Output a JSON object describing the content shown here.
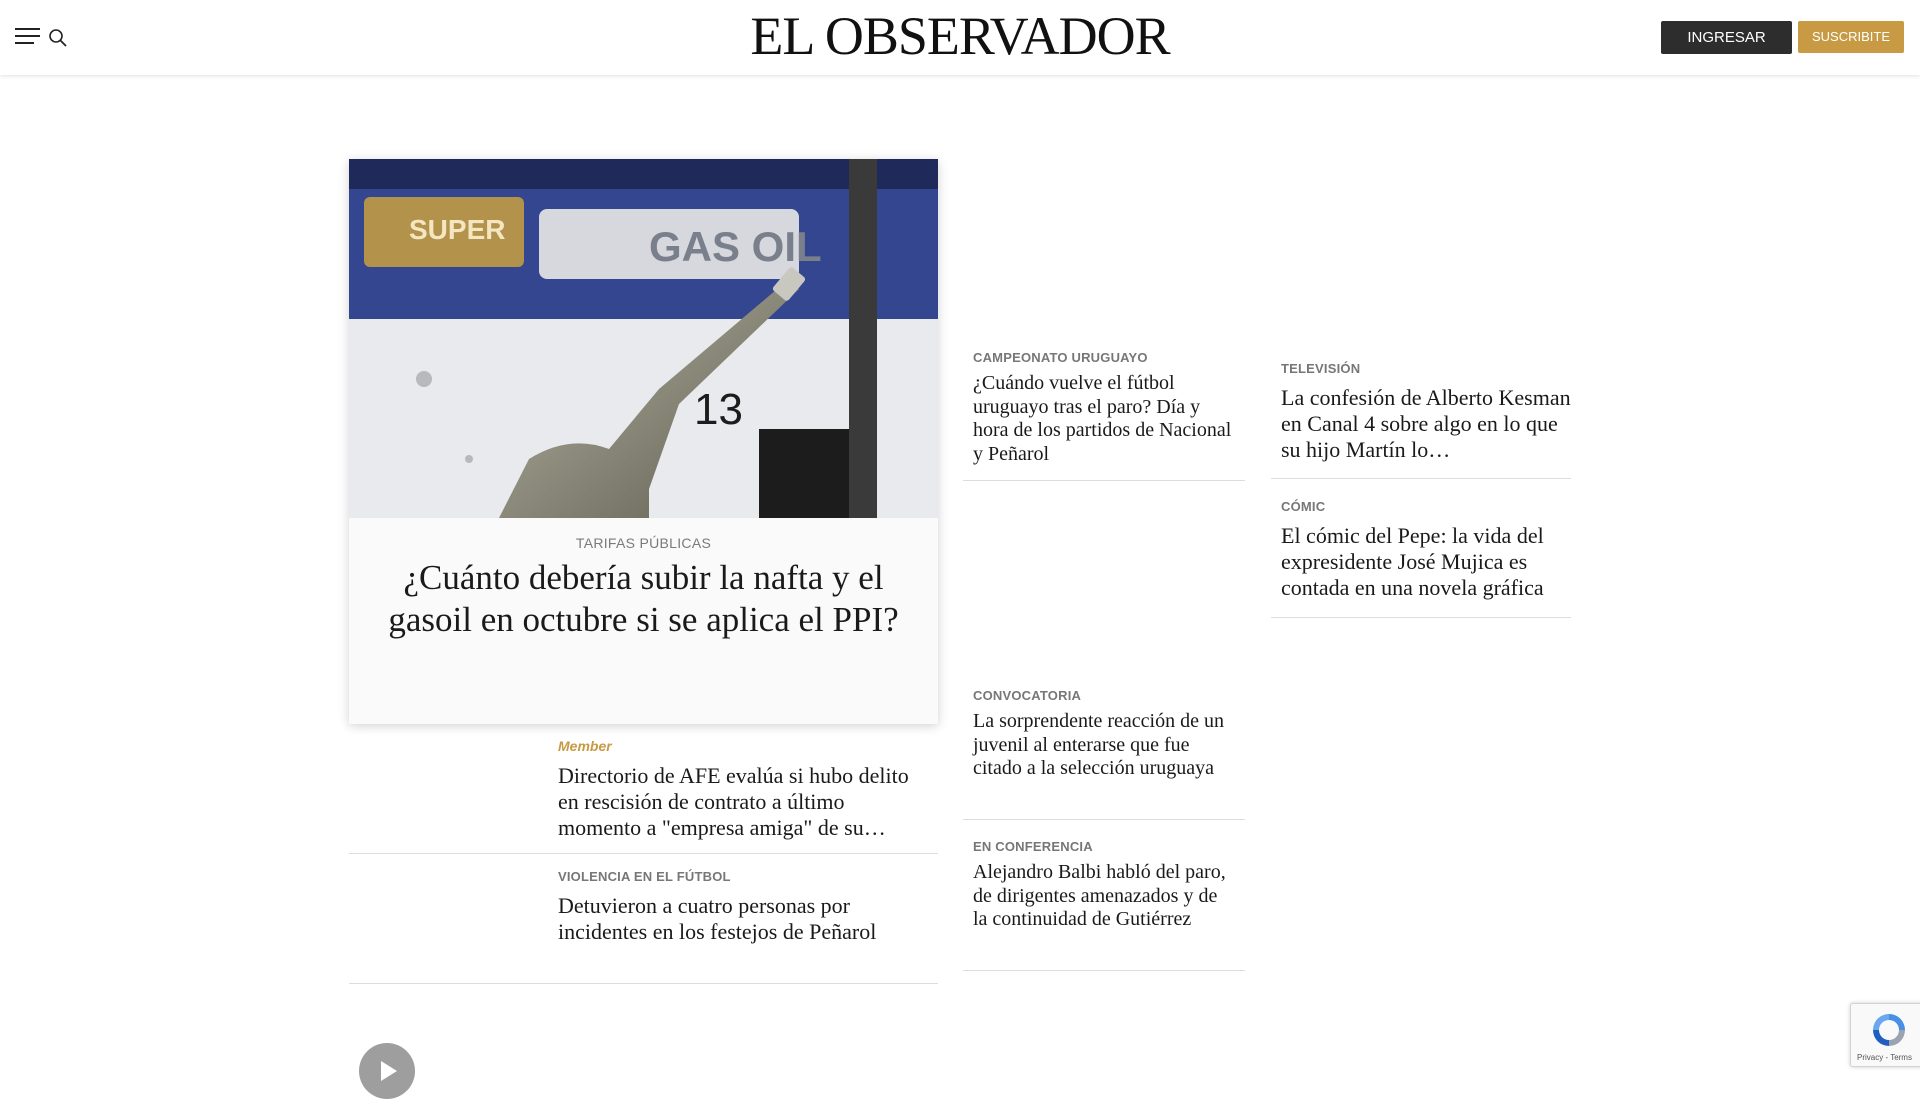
{
  "header": {
    "logo": "EL OBSERVADOR",
    "login_label": "INGRESAR",
    "subscribe_label": "SUSCRIBITE"
  },
  "main_story": {
    "image_texts": [
      "SUPER",
      "GAS OIL",
      "13"
    ],
    "kicker": "TARIFAS PÚBLICAS",
    "title": "¿Cuánto debería subir la nafta y el gasoil en octubre si se aplica el PPI?"
  },
  "left_column": [
    {
      "kicker": "Member",
      "title": "Directorio de AFE evalúa si hubo delito en rescisión de contrato a último momento a \"empresa amiga\" de su…"
    },
    {
      "kicker": "VIOLENCIA EN EL FÚTBOL",
      "title": "Detuvieron a cuatro personas por incidentes en los festejos de Peñarol"
    }
  ],
  "middle_column": [
    {
      "kicker": "CAMPEONATO URUGUAYO",
      "title": "¿Cuándo vuelve el fútbol uruguayo tras el paro? Día y hora de los partidos de Nacional y Peñarol"
    },
    {
      "kicker": "CONVOCATORIA",
      "title": "La sorprendente reacción de un juvenil al enterarse que fue citado a la selección uruguaya"
    },
    {
      "kicker": "EN CONFERENCIA",
      "title": "Alejandro Balbi habló del paro, de dirigentes amenazados y de la continuidad de Gutiérrez"
    }
  ],
  "right_column": [
    {
      "kicker": "TELEVISIÓN",
      "title": "La confesión de Alberto Kesman en Canal 4 sobre algo en lo que su hijo Martín lo…"
    },
    {
      "kicker": "CÓMIC",
      "title": "El cómic del Pepe: la vida del expresidente José Mujica es contada en una novela gráfica"
    }
  ],
  "recaptcha": {
    "text": "Privacy - Terms"
  },
  "colors": {
    "accent_gold": "#c79a43",
    "login_bg": "#2d2d2d",
    "kicker_gray": "#777777"
  }
}
